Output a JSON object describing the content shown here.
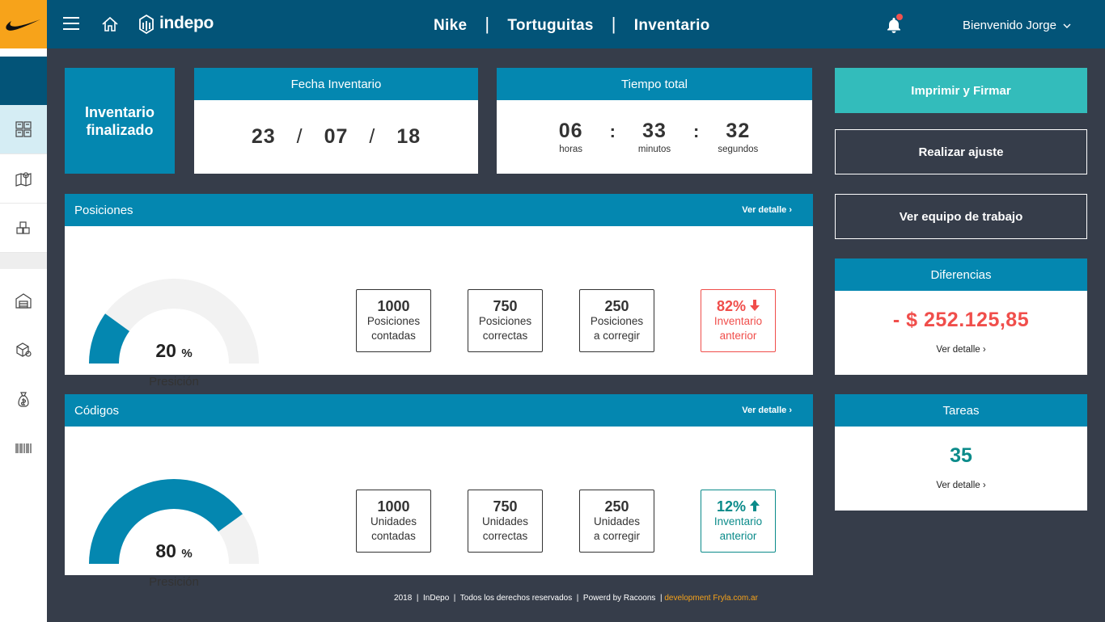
{
  "topbar": {
    "brand": "indepo",
    "crumbs": [
      "Nike",
      "Tortuguitas",
      "Inventario"
    ],
    "crumb_sep": "|",
    "user_greeting": "Bienvenido Jorge"
  },
  "status": {
    "line1": "Inventario",
    "line2": "finalizado"
  },
  "fecha": {
    "title": "Fecha Inventario",
    "day": "23",
    "month": "07",
    "year": "18",
    "sep": "/"
  },
  "tiempo": {
    "title": "Tiempo total",
    "hours": "06",
    "hours_label": "horas",
    "minutes": "33",
    "minutes_label": "minutos",
    "seconds": "32",
    "seconds_label": "segundos",
    "colon": ":"
  },
  "posiciones": {
    "title": "Posiciones",
    "link": "Ver detalle ›",
    "gauge_percent": 20,
    "gauge_value": "20",
    "gauge_unit": "%",
    "gauge_label": "Presición",
    "stats": [
      {
        "num": "1000",
        "l1": "Posiciones",
        "l2": "contadas"
      },
      {
        "num": "750",
        "l1": "Posiciones",
        "l2": "correctas"
      },
      {
        "num": "250",
        "l1": "Posiciones",
        "l2": "a corregir"
      },
      {
        "num": "82%",
        "l1": "Inventario",
        "l2": "anterior",
        "trend": "down"
      }
    ]
  },
  "codigos": {
    "title": "Códigos",
    "link": "Ver detalle ›",
    "gauge_percent": 80,
    "gauge_value": "80",
    "gauge_unit": "%",
    "gauge_label": "Presición",
    "stats": [
      {
        "num": "1000",
        "l1": "Unidades",
        "l2": "contadas"
      },
      {
        "num": "750",
        "l1": "Unidades",
        "l2": "correctas"
      },
      {
        "num": "250",
        "l1": "Unidades",
        "l2": "a corregir"
      },
      {
        "num": "12%",
        "l1": "Inventario",
        "l2": "anterior",
        "trend": "up"
      }
    ]
  },
  "actions": {
    "print": "Imprimir y Firmar",
    "adjust": "Realizar ajuste",
    "team": "Ver equipo de trabajo"
  },
  "diferencias": {
    "title": "Diferencias",
    "value": "- $ 252.125,85",
    "link": "Ver detalle ›"
  },
  "tareas": {
    "title": "Tareas",
    "value": "35",
    "link": "Ver detalle ›"
  },
  "footer": {
    "text": "2018  |  InDepo  |  Todos los derechos reservados  |  Powerd by Racoons  |",
    "dev": "development Fryla.com.ar"
  },
  "colors": {
    "accent": "#0487b0",
    "topbar": "#035478",
    "background": "#363d4a",
    "teal_button": "#33bcbb",
    "negative": "#f04e4b",
    "positive": "#0b8b8a",
    "logo_bg": "#f7a31a"
  },
  "icons": {
    "sidebar": [
      "inventory-grid-icon",
      "map-icon",
      "boxes-icon",
      "warehouse-icon",
      "package-search-icon",
      "money-bag-icon",
      "barcode-icon"
    ]
  }
}
